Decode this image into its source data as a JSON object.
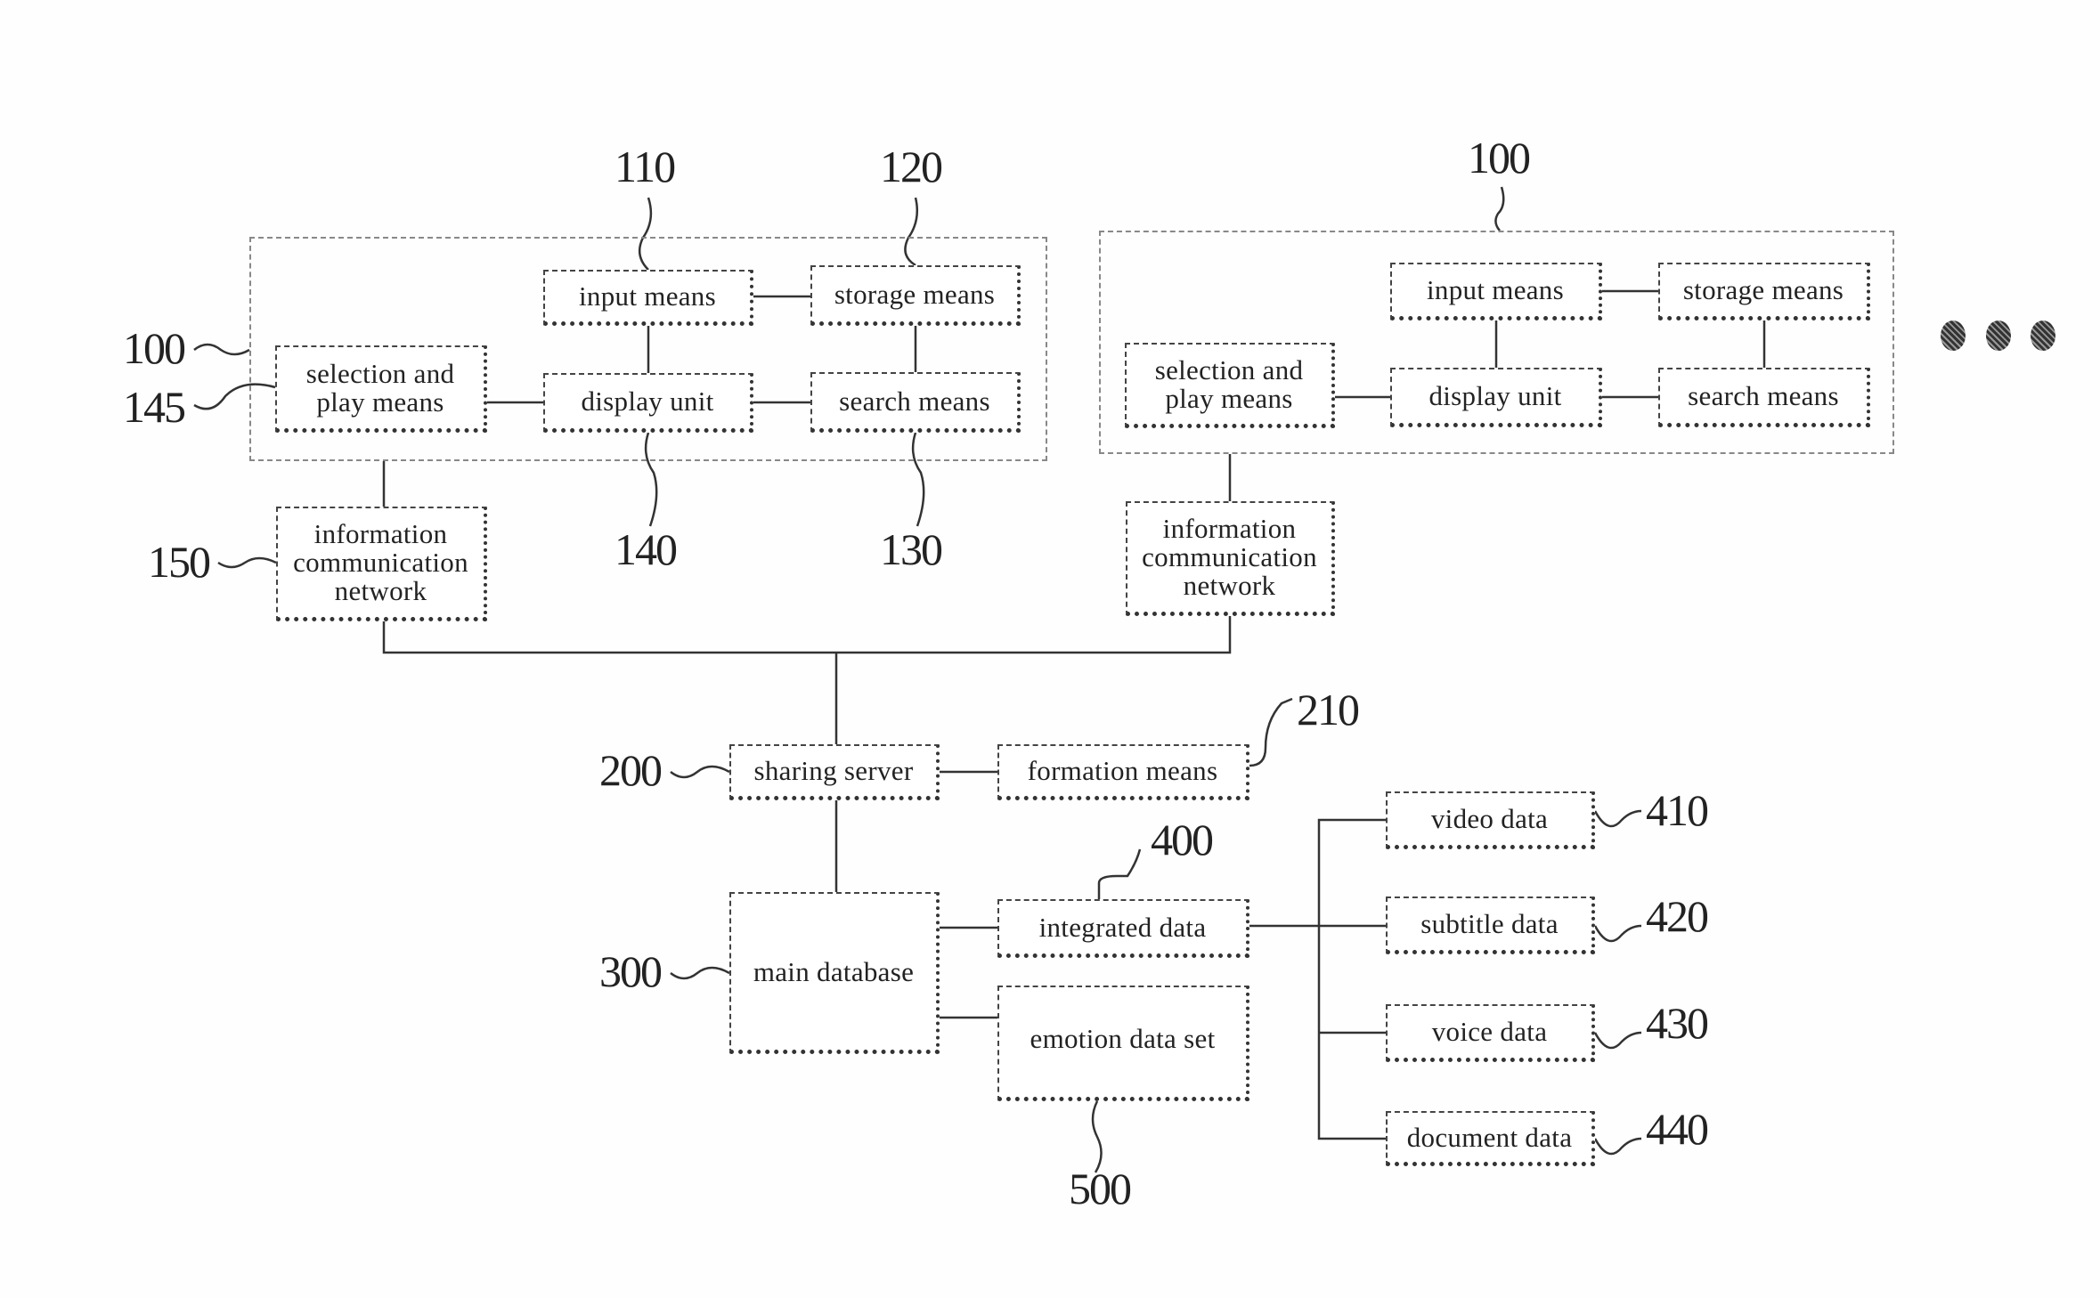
{
  "figure": {
    "left_terminal": {
      "ref": "100",
      "play_ref": "145",
      "input_means": {
        "label": "input means",
        "ref": "110"
      },
      "storage_means": {
        "label": "storage means",
        "ref": "120"
      },
      "selection_play": {
        "label_line1": "selection and",
        "label_line2": "play means"
      },
      "display_unit": {
        "label": "display unit",
        "ref": "140"
      },
      "search_means": {
        "label": "search means",
        "ref": "130"
      },
      "network": {
        "line1": "information",
        "line2": "communication",
        "line3": "network",
        "ref": "150"
      }
    },
    "right_terminal": {
      "ref": "100",
      "input_means": {
        "label": "input means"
      },
      "storage_means": {
        "label": "storage means"
      },
      "selection_play": {
        "label_line1": "selection and",
        "label_line2": "play means"
      },
      "display_unit": {
        "label": "display unit"
      },
      "search_means": {
        "label": "search means"
      },
      "network": {
        "line1": "information",
        "line2": "communication",
        "line3": "network"
      }
    },
    "ellipsis_icon": "more-terminals-dots",
    "sharing_server": {
      "label": "sharing server",
      "ref": "200"
    },
    "formation_means": {
      "label": "formation means",
      "ref": "210"
    },
    "main_database": {
      "label": "main database",
      "ref": "300"
    },
    "integrated_data": {
      "label": "integrated data",
      "ref": "400"
    },
    "emotion_data_set": {
      "label": "emotion data set",
      "ref": "500"
    },
    "video_data": {
      "label": "video data",
      "ref": "410"
    },
    "subtitle_data": {
      "label": "subtitle data",
      "ref": "420"
    },
    "voice_data": {
      "label": "voice data",
      "ref": "430"
    },
    "document_data": {
      "label": "document data",
      "ref": "440"
    }
  }
}
